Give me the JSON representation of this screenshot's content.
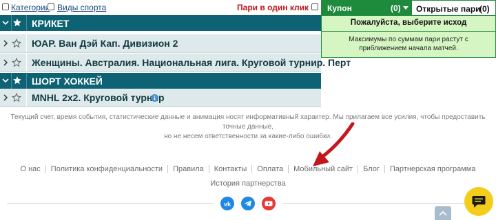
{
  "topbar": {
    "categories_label": "Категории",
    "sports_label": "Виды спорта",
    "one_click_label": "Пари в один клик"
  },
  "sports": [
    {
      "title": "КРИКЕТ",
      "leagues": [
        "ЮАР. Ван Дэй Кап. Дивизион 2",
        "Женщины. Австралия. Национальная лига. Круговой турнир. Перт"
      ]
    },
    {
      "title": "ШОРТ ХОККЕЙ",
      "leagues": [
        "MNHL 2x2. Круговой турнир"
      ]
    }
  ],
  "coupon": {
    "tab_label": "Купон",
    "count": "(0)",
    "open_bets_label": "Открытые пари",
    "open_count": "(0)",
    "prompt": "Пожалуйста, выберите исход",
    "info": "Максимумы по суммам пари растут с приближением начала матчей."
  },
  "disclaimer": {
    "line1": "Текущий счет, время события, статистические данные и анимация носят информативный характер. Мы прилагаем все усилия, чтобы предоставить точные данные,",
    "line2": "но не несем ответственности за какие-либо ошибки."
  },
  "footer": {
    "links": [
      "О нас",
      "Политика конфиденциальности",
      "Правила",
      "Контакты",
      "Оплата",
      "Мобильный сайт",
      "Блог",
      "Партнерская программа"
    ],
    "links_row2": [
      "История партнерства"
    ],
    "social": [
      "vk-icon",
      "telegram-icon",
      "youtube-icon"
    ]
  },
  "colors": {
    "sport_header": "#0d6374",
    "league_row": "#dde9ea",
    "coupon_tab": "#1e8a3b",
    "coupon_body": "#d5f6c2",
    "one_click": "#c0161c",
    "chat_button": "#f4cc1a",
    "arrow": "#c4171d"
  }
}
